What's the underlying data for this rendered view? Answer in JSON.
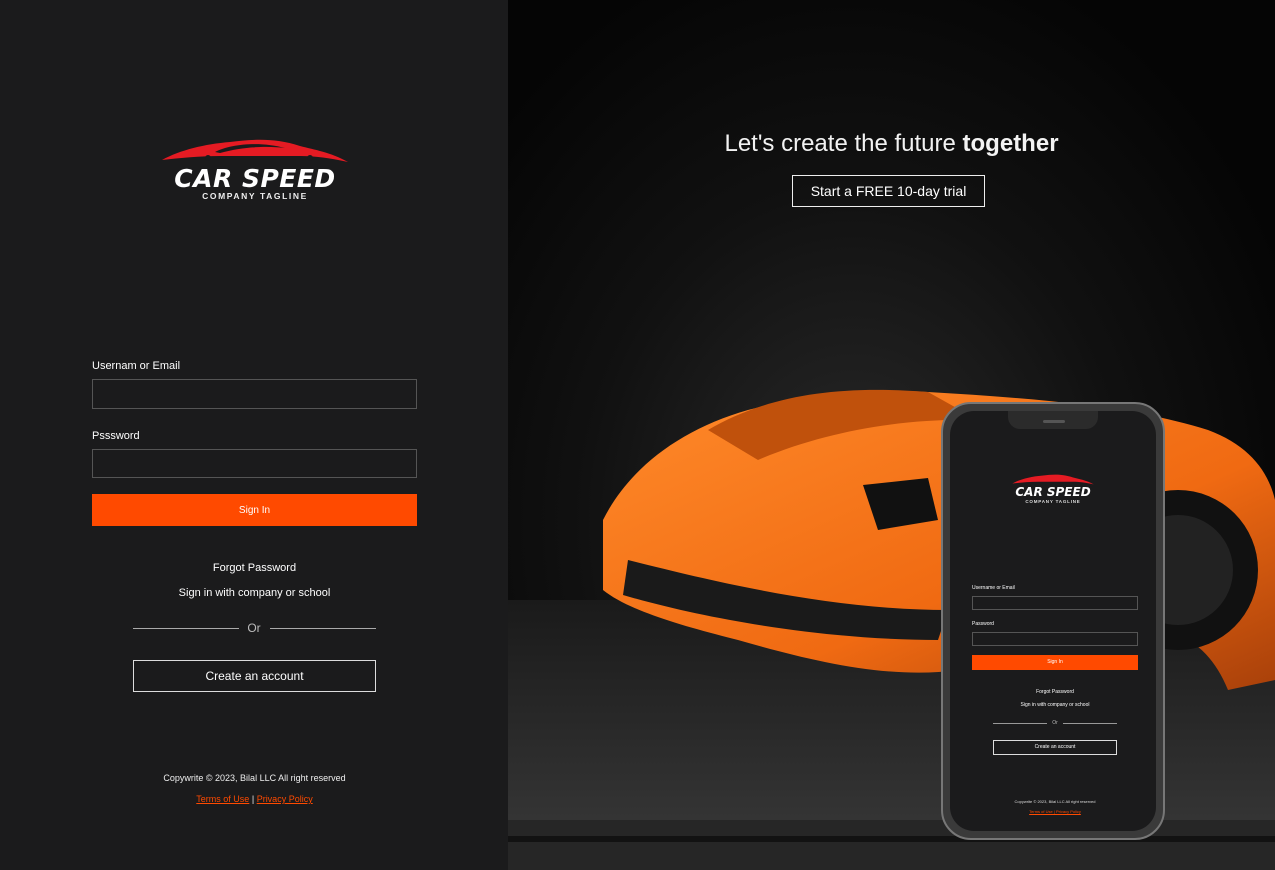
{
  "brand": {
    "name": "CAR SPEED",
    "tagline": "COMPANY TAGLINE",
    "accent_color": "#ff4a00",
    "logo_color": "#e51b23"
  },
  "login": {
    "username_label": "Usernam or Email",
    "username_value": "",
    "password_label": "Psssword",
    "password_value": "",
    "signin_label": "Sign In",
    "forgot_label": "Forgot Password",
    "company_signin_label": "Sign in with company or school",
    "or_label": "Or",
    "create_account_label": "Create an account"
  },
  "footer": {
    "copyright": "Copywrite © 2023, Bilal LLC All right reserved",
    "terms_label": "Terms of Use",
    "separator": "|",
    "privacy_label": "Privacy Policy"
  },
  "hero": {
    "headline_prefix": "Let's create the future",
    "headline_emphasis": "together",
    "trial_label": "Start a FREE 10-day trial",
    "car_color": "#f06a12"
  },
  "phone": {
    "brand_name": "CAR SPEED",
    "brand_tagline": "COMPANY TAGLINE",
    "username_label": "Username or Email",
    "password_label": "Password",
    "signin_label": "Sign In",
    "forgot_label": "Forgot Password",
    "company_signin_label": "Sign in with company or school",
    "or_label": "Or",
    "create_account_label": "Create an account",
    "copyright": "Copywrite © 2023, Bilal LLC All right reserved",
    "legal": "Terms of Use | Privacy Policy"
  }
}
